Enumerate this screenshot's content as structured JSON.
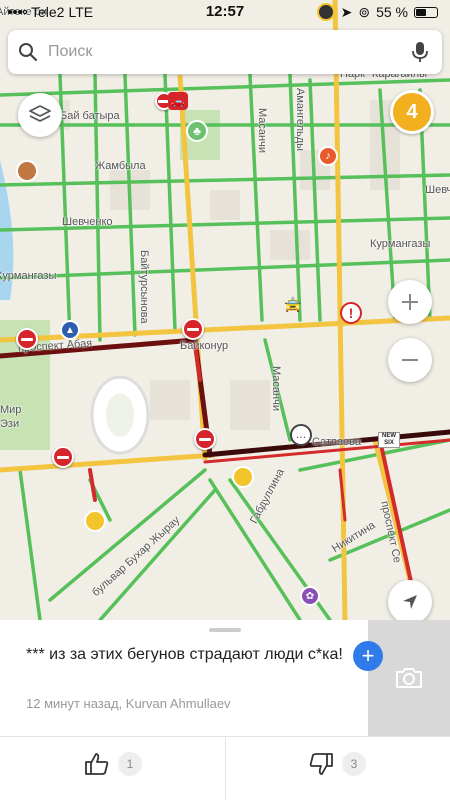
{
  "status_bar": {
    "carrier": "Tele2",
    "network": "LTE",
    "time": "12:57",
    "battery": "55 %",
    "battery_level": 0.55
  },
  "search": {
    "placeholder": "Поиск"
  },
  "map": {
    "streets": {
      "ayteke_bi": "Айтеке би",
      "park_karagaily": "Парк \"Карагайлы\"",
      "bay_batyra": "Бай батыра",
      "zhambyla": "Жамбыла",
      "shevchenko_left": "Шевченко",
      "shevchenko_right": "Шевч",
      "kurmangazy_left": "Курмангазы",
      "kurmangazy_right": "Курмангазы",
      "baitursynova": "Байтурсынова",
      "masanchi_top": "Масанчи",
      "masanchi_bottom": "Масанчи",
      "amangeldy": "Амангельды",
      "prospekt_abaya": "проспект Абая",
      "baikonur": "Байконур",
      "satpaeva": "Сатпаева",
      "buhar_zhyrau": "бульвар Бухар Жырау",
      "gabdullina": "Габдуллина",
      "nikitina": "Никитина",
      "prospekt_side": "проспект Се",
      "mir": "Мир",
      "mir2": "Эзи"
    },
    "new_six": "NEW SIX",
    "cluster_count": "4"
  },
  "comment": {
    "text": "*** из за этих бегунов страдают люди с*ка!",
    "meta": "12 минут назад, Kurvan Ahmullaev"
  },
  "votes": {
    "likes": "1",
    "dislikes": "3"
  }
}
